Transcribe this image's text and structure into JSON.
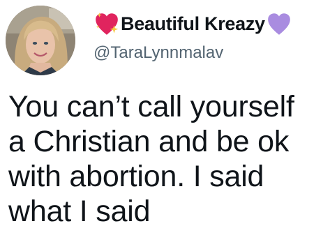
{
  "tweet": {
    "author": {
      "display_name": "Beautiful Kreazy",
      "handle": "@TaraLynnmalav",
      "leading_emoji": "sparkling-heart",
      "trailing_emoji": "purple-heart"
    },
    "text_lines": [
      "You can’t call yourself",
      "a Christian and be ok",
      "with abortion.  I said",
      "what I said"
    ]
  },
  "colors": {
    "text_primary": "#0f1419",
    "text_secondary": "#536471",
    "heart_red": "#e0245e",
    "heart_purple": "#a98ce0",
    "sparkle_yellow": "#f7c948"
  }
}
